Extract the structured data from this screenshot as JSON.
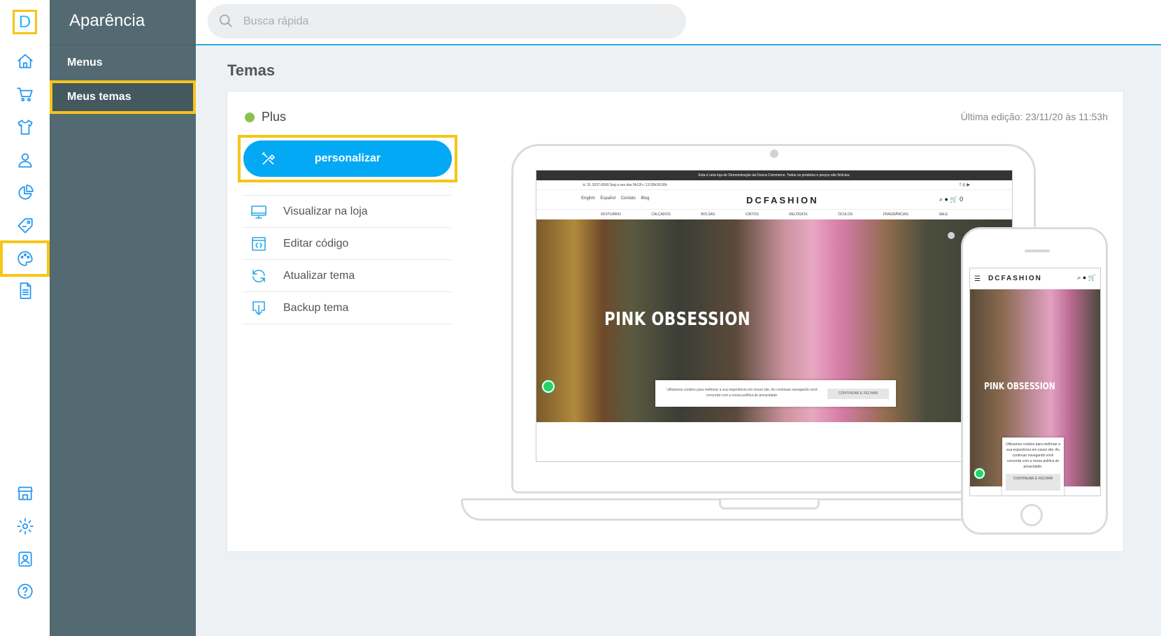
{
  "app": {
    "logo_letter": "D"
  },
  "rail": {
    "items": [
      "home",
      "cart",
      "products",
      "customers",
      "reports",
      "coupons",
      "appearance",
      "pages"
    ],
    "bottom_items": [
      "store",
      "settings",
      "account",
      "help"
    ],
    "active": "appearance",
    "accent_color": "#2196f3",
    "highlight_color": "#f5c518"
  },
  "sidemenu": {
    "title": "Aparência",
    "items": [
      {
        "label": "Menus"
      },
      {
        "label": "Meus temas"
      }
    ],
    "selected": "Meus temas"
  },
  "search": {
    "placeholder": "Busca rápida"
  },
  "page": {
    "title": "Temas"
  },
  "theme": {
    "name": "Plus",
    "status_color": "#8bc34a",
    "last_edit": "Última edição: 23/11/20 às 11:53h",
    "customize_button": "personalizar",
    "actions": [
      {
        "label": "Visualizar na loja",
        "icon": "monitor-icon"
      },
      {
        "label": "Editar código",
        "icon": "code-icon"
      },
      {
        "label": "Atualizar tema",
        "icon": "refresh-icon"
      },
      {
        "label": "Backup tema",
        "icon": "download-icon"
      }
    ]
  },
  "preview": {
    "announcement": "Esta é uma loja de Demonstração da Dooca Commerce. Todos os produtos e preços são fictícios.",
    "contact": "☏ 51 2037-6560 Seg a sex das 9h12h / 13:30h18:30h",
    "languages": [
      "English",
      "Español",
      "Contato",
      "Blog"
    ],
    "brand": "DCFASHION",
    "cart_count": "0",
    "nav": [
      "VESTUÁRIO",
      "CALÇADOS",
      "BOLSAS",
      "CINTOS",
      "RELÓGIOS",
      "ÓCULOS",
      "FRAGRÂNCIAS",
      "SALE"
    ],
    "hero_title": "PINK OBSESSION",
    "cookie_text": "Utilizamos cookies para melhorar a sua experiência em nosso site. Ao continuar navegando você concorda com a nossa política de privacidade.",
    "cookie_button": "CONTINUAR E FECHAR",
    "mobile_cookie_button": "CONTINUAR E FECHAR"
  }
}
